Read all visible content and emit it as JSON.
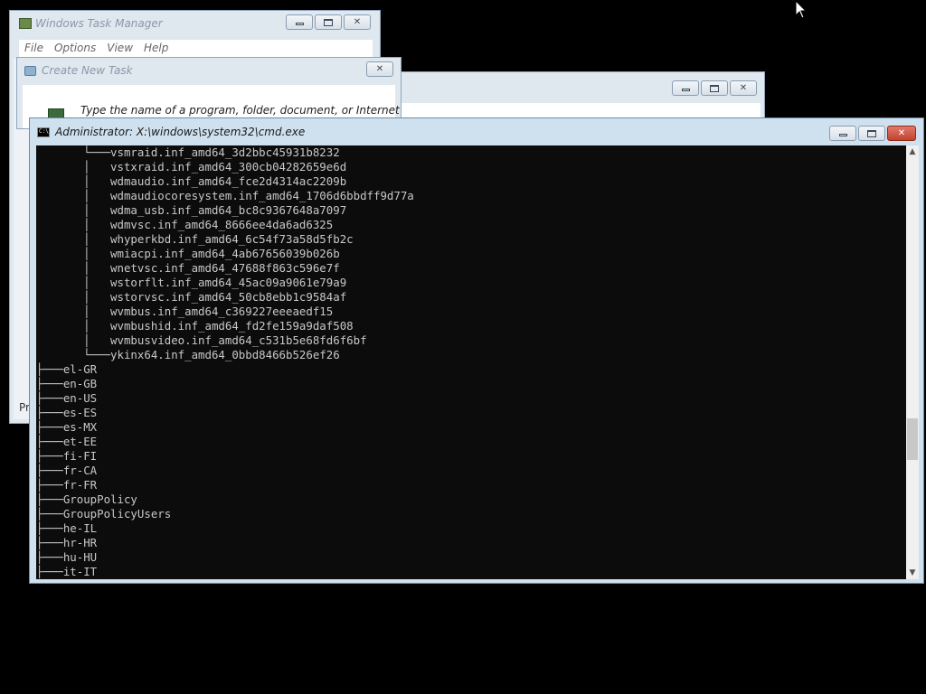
{
  "task_manager": {
    "title": "Windows Task Manager",
    "menu": [
      "File",
      "Options",
      "View",
      "Help"
    ],
    "status_fragment": "Pr"
  },
  "create_task": {
    "title": "Create New Task",
    "prompt": "Type the name of a program, folder, document, or Internet"
  },
  "cmd": {
    "title": "Administrator: X:\\windows\\system32\\cmd.exe",
    "lines": [
      "       └───vsmraid.inf_amd64_3d2bbc45931b8232",
      "       │   vstxraid.inf_amd64_300cb04282659e6d",
      "       │   wdmaudio.inf_amd64_fce2d4314ac2209b",
      "       │   wdmaudiocoresystem.inf_amd64_1706d6bbdff9d77a",
      "       │   wdma_usb.inf_amd64_bc8c9367648a7097",
      "       │   wdmvsc.inf_amd64_8666ee4da6ad6325",
      "       │   whyperkbd.inf_amd64_6c54f73a58d5fb2c",
      "       │   wmiacpi.inf_amd64_4ab67656039b026b",
      "       │   wnetvsc.inf_amd64_47688f863c596e7f",
      "       │   wstorflt.inf_amd64_45ac09a9061e79a9",
      "       │   wstorvsc.inf_amd64_50cb8ebb1c9584af",
      "       │   wvmbus.inf_amd64_c369227eeeaedf15",
      "       │   wvmbushid.inf_amd64_fd2fe159a9daf508",
      "       │   wvmbusvideo.inf_amd64_c531b5e68fd6f6bf",
      "       └───ykinx64.inf_amd64_0bbd8466b526ef26",
      "├───el-GR",
      "├───en-GB",
      "├───en-US",
      "├───es-ES",
      "├───es-MX",
      "├───et-EE",
      "├───fi-FI",
      "├───fr-CA",
      "├───fr-FR",
      "├───GroupPolicy",
      "├───GroupPolicyUsers",
      "├───he-IL",
      "├───hr-HR",
      "├───hu-HU",
      "├───it-IT"
    ]
  },
  "icons": {
    "minimize": "minimize-icon",
    "maximize": "maximize-icon",
    "close": "close-icon",
    "scroll_up": "chevron-up-icon",
    "scroll_down": "chevron-down-icon",
    "cursor": "mouse-pointer-icon"
  },
  "colors": {
    "console_bg": "#0c0c0c",
    "console_fg": "#c8c8c8",
    "close_red": "#c2432f"
  }
}
